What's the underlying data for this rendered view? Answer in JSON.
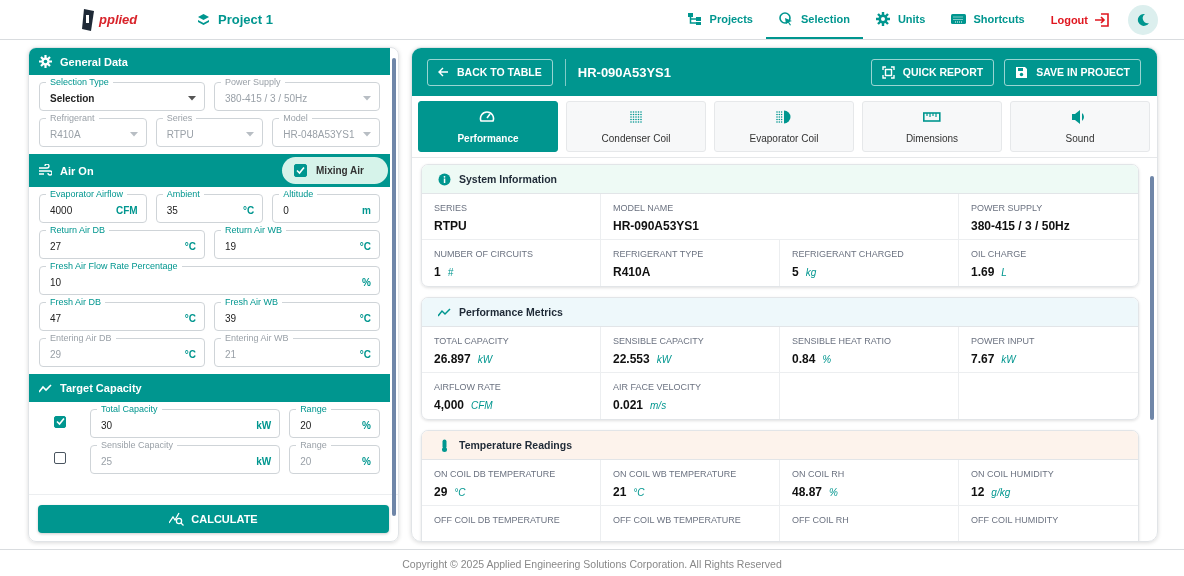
{
  "header": {
    "logo": "pplied",
    "project": "Project 1",
    "nav": [
      {
        "label": "Projects",
        "selected": false
      },
      {
        "label": "Selection",
        "selected": true
      },
      {
        "label": "Units",
        "selected": false
      },
      {
        "label": "Shortcuts",
        "selected": false
      }
    ],
    "logout": "Logout"
  },
  "left_panel": {
    "sections": [
      {
        "kind": "general",
        "title": "General Data",
        "rows": [
          [
            {
              "kind": "select",
              "label": "Selection Type",
              "value": "Selection",
              "disabled": false
            },
            {
              "kind": "select",
              "label": "Power Supply",
              "value": "380-415 / 3 / 50Hz",
              "disabled": true
            }
          ],
          [
            {
              "kind": "select",
              "label": "Refrigerant",
              "value": "R410A",
              "disabled": true
            },
            {
              "kind": "select",
              "label": "Series",
              "value": "RTPU",
              "disabled": true
            },
            {
              "kind": "select",
              "label": "Model",
              "value": "HR-048A53YS1",
              "disabled": true
            }
          ]
        ]
      },
      {
        "kind": "air",
        "title": "Air On",
        "toggle": {
          "label": "Mixing Air",
          "checked": true
        },
        "rows": [
          [
            {
              "kind": "input",
              "label": "Evaporator Airflow",
              "value": "4000",
              "unit": "CFM",
              "disabled": false
            },
            {
              "kind": "input",
              "label": "Ambient",
              "value": "35",
              "unit": "°C",
              "disabled": false
            },
            {
              "kind": "input",
              "label": "Altitude",
              "value": "0",
              "unit": "m",
              "disabled": false
            }
          ],
          [
            {
              "kind": "input",
              "label": "Return Air DB",
              "value": "27",
              "unit": "°C",
              "disabled": false
            },
            {
              "kind": "input",
              "label": "Return Air WB",
              "value": "19",
              "unit": "°C",
              "disabled": false
            }
          ],
          [
            {
              "kind": "input",
              "label": "Fresh Air Flow Rate Percentage",
              "value": "10",
              "unit": "%",
              "disabled": false
            }
          ],
          [
            {
              "kind": "input",
              "label": "Fresh Air DB",
              "value": "47",
              "unit": "°C",
              "disabled": false
            },
            {
              "kind": "input",
              "label": "Fresh Air WB",
              "value": "39",
              "unit": "°C",
              "disabled": false
            }
          ],
          [
            {
              "kind": "input",
              "label": "Entering Air DB",
              "value": "29",
              "unit": "°C",
              "disabled": true
            },
            {
              "kind": "input",
              "label": "Entering Air WB",
              "value": "21",
              "unit": "°C",
              "disabled": true
            }
          ]
        ]
      },
      {
        "kind": "target",
        "title": "Target Capacity",
        "targets": [
          {
            "checked": true,
            "fields": [
              {
                "kind": "input",
                "label": "Total Capacity",
                "value": "30",
                "unit": "kW",
                "disabled": false
              },
              {
                "kind": "input",
                "label": "Range",
                "value": "20",
                "unit": "%",
                "disabled": false
              }
            ]
          },
          {
            "checked": false,
            "fields": [
              {
                "kind": "input",
                "label": "Sensible Capacity",
                "value": "25",
                "unit": "kW",
                "disabled": true
              },
              {
                "kind": "input",
                "label": "Range",
                "value": "20",
                "unit": "%",
                "disabled": true
              }
            ]
          }
        ]
      }
    ],
    "calculate": "CALCULATE"
  },
  "right_panel": {
    "back": "BACK TO TABLE",
    "model": "HR-090A53YS1",
    "actions": [
      "QUICK REPORT",
      "SAVE IN PROJECT"
    ],
    "tabs": [
      {
        "label": "Performance",
        "selected": true
      },
      {
        "label": "Condenser Coil",
        "selected": false
      },
      {
        "label": "Evaporator Coil",
        "selected": false
      },
      {
        "label": "Dimensions",
        "selected": false
      },
      {
        "label": "Sound",
        "selected": false
      }
    ],
    "cards": [
      {
        "kind": "info",
        "title": "System Information",
        "rows": [
          [
            {
              "label": "SERIES",
              "value": "RTPU"
            },
            {
              "label": "MODEL NAME",
              "value": "HR-090A53YS1"
            },
            "",
            {
              "label": "POWER SUPPLY",
              "value": "380-415 / 3 / 50Hz"
            }
          ],
          [
            {
              "label": "NUMBER OF CIRCUITS",
              "value": "1",
              "unit": "#"
            },
            {
              "label": "REFRIGERANT TYPE",
              "value": "R410A"
            },
            {
              "label": "REFRIGERANT CHARGED",
              "value": "5",
              "unit": "kg"
            },
            {
              "label": "OIL CHARGE",
              "value": "1.69",
              "unit": "L"
            }
          ]
        ]
      },
      {
        "kind": "metrics",
        "title": "Performance Metrics",
        "rows": [
          [
            {
              "label": "TOTAL CAPACITY",
              "value": "26.897",
              "unit": "kW"
            },
            {
              "label": "SENSIBLE CAPACITY",
              "value": "22.553",
              "unit": "kW"
            },
            {
              "label": "SENSIBLE HEAT RATIO",
              "value": "0.84",
              "unit": "%"
            },
            {
              "label": "POWER INPUT",
              "value": "7.67",
              "unit": "kW"
            }
          ],
          [
            {
              "label": "AIRFLOW RATE",
              "value": "4,000",
              "unit": "CFM"
            },
            {
              "label": "AIR FACE VELOCITY",
              "value": "0.021",
              "unit": "m/s"
            }
          ]
        ]
      },
      {
        "kind": "temperature",
        "title": "Temperature Readings",
        "rows": [
          [
            {
              "label": "ON COIL DB TEMPERATURE",
              "value": "29",
              "unit": "°C"
            },
            {
              "label": "ON COIL WB TEMPERATURE",
              "value": "21",
              "unit": "°C"
            },
            {
              "label": "ON COIL RH",
              "value": "48.87",
              "unit": "%"
            },
            {
              "label": "ON COIL HUMIDITY",
              "value": "12",
              "unit": "g/kg"
            }
          ],
          [
            {
              "label": "OFF COIL DB TEMPERATURE"
            },
            {
              "label": "OFF COIL WB TEMPERATURE"
            },
            {
              "label": "OFF COIL RH"
            },
            {
              "label": "OFF COIL HUMIDITY"
            }
          ]
        ]
      }
    ]
  },
  "footer": "Copyright © 2025 Applied Engineering Solutions Corporation. All Rights Reserved"
}
